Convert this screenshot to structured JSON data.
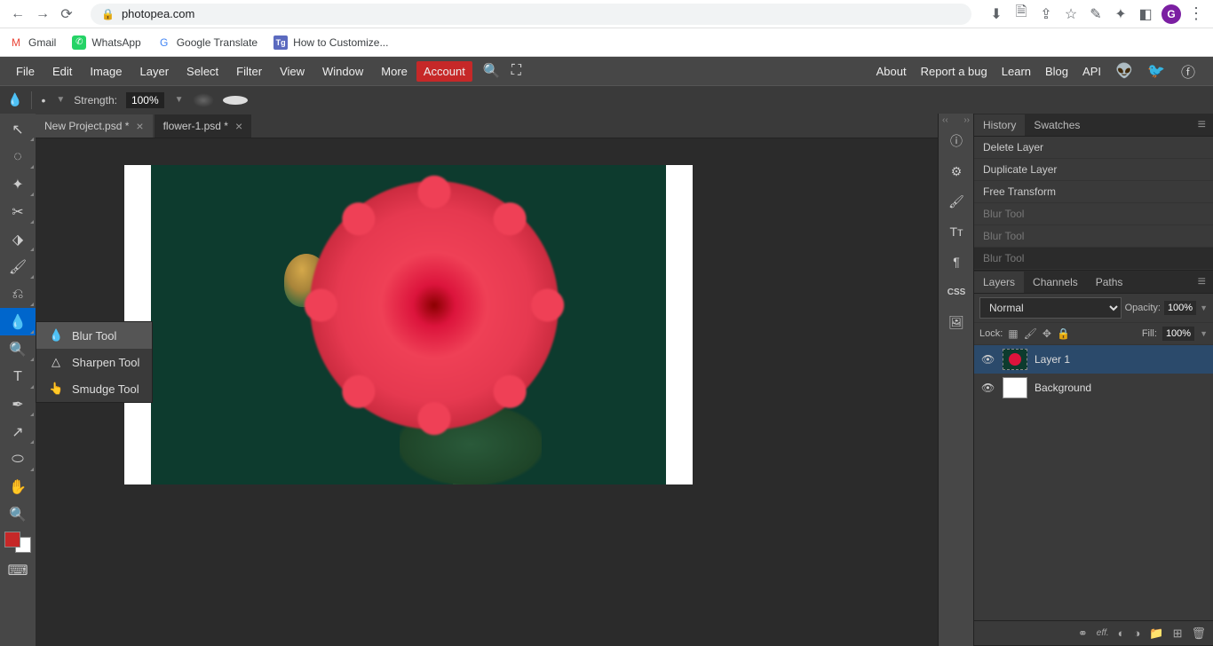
{
  "browser": {
    "url": "photopea.com",
    "profile_initial": "G",
    "bookmarks": [
      {
        "label": "Gmail"
      },
      {
        "label": "WhatsApp"
      },
      {
        "label": "Google Translate"
      },
      {
        "label": "How to Customize..."
      }
    ]
  },
  "menubar": {
    "items": [
      "File",
      "Edit",
      "Image",
      "Layer",
      "Select",
      "Filter",
      "View",
      "Window",
      "More"
    ],
    "account": "Account",
    "right_links": [
      "About",
      "Report a bug",
      "Learn",
      "Blog",
      "API"
    ]
  },
  "options_bar": {
    "strength_label": "Strength:",
    "strength_value": "100%"
  },
  "tabs": [
    {
      "label": "New Project.psd *",
      "active": true
    },
    {
      "label": "flower-1.psd *",
      "active": false
    }
  ],
  "tool_flyout": [
    {
      "label": "Blur Tool",
      "icon": "💧"
    },
    {
      "label": "Sharpen Tool",
      "icon": "△"
    },
    {
      "label": "Smudge Tool",
      "icon": "👆"
    }
  ],
  "history_panel": {
    "tabs": [
      "History",
      "Swatches"
    ],
    "items": [
      {
        "label": "Delete Layer"
      },
      {
        "label": "Duplicate Layer"
      },
      {
        "label": "Free Transform"
      },
      {
        "label": "Blur Tool",
        "dim": true
      },
      {
        "label": "Blur Tool",
        "dim": true
      },
      {
        "label": "Blur Tool",
        "dim": true,
        "active": true
      }
    ]
  },
  "layers_panel": {
    "tabs": [
      "Layers",
      "Channels",
      "Paths"
    ],
    "blend_mode": "Normal",
    "opacity_label": "Opacity:",
    "opacity_value": "100%",
    "lock_label": "Lock:",
    "fill_label": "Fill:",
    "fill_value": "100%",
    "layers": [
      {
        "name": "Layer 1",
        "selected": true
      },
      {
        "name": "Background",
        "selected": false
      }
    ]
  }
}
